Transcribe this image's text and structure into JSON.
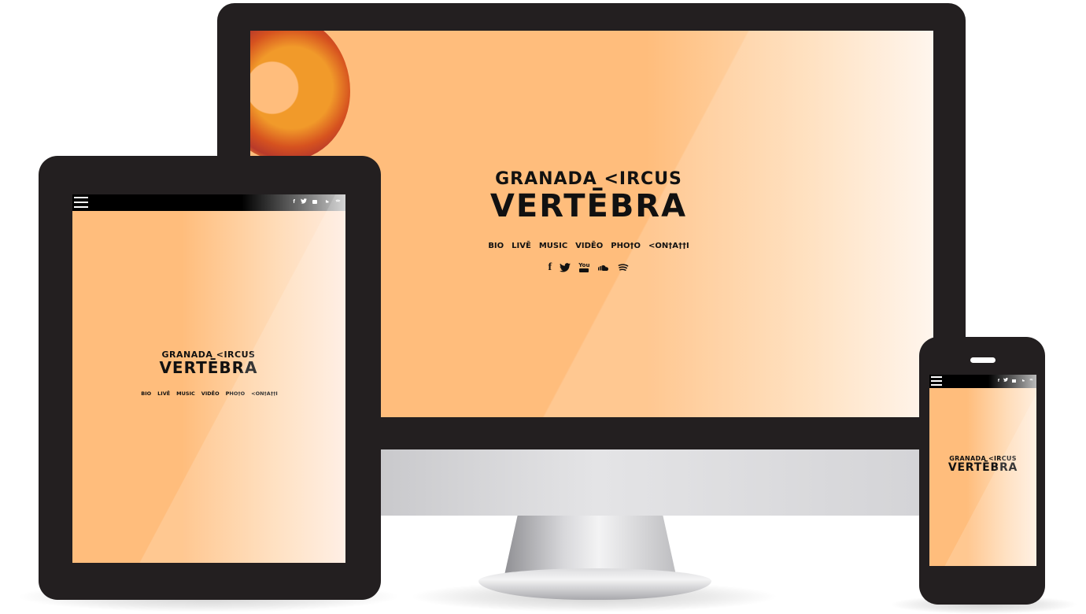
{
  "brand": {
    "line1": "GRANADA <IRCUS",
    "line2": "VERTĒBRA"
  },
  "nav": {
    "items": [
      "BIO",
      "LIVĒ",
      "MUSIC",
      "VIDĒO",
      "PHO†O",
      "<ON†A††I"
    ]
  },
  "social": {
    "facebook_glyph": "f",
    "twitter_glyph": "🐦",
    "youtube_glyph": "You",
    "soundcloud_glyph": "☁",
    "spotify_glyph": "≋"
  },
  "colors": {
    "screen_orange": "#ffbd7c",
    "device_frame": "#231f20"
  }
}
